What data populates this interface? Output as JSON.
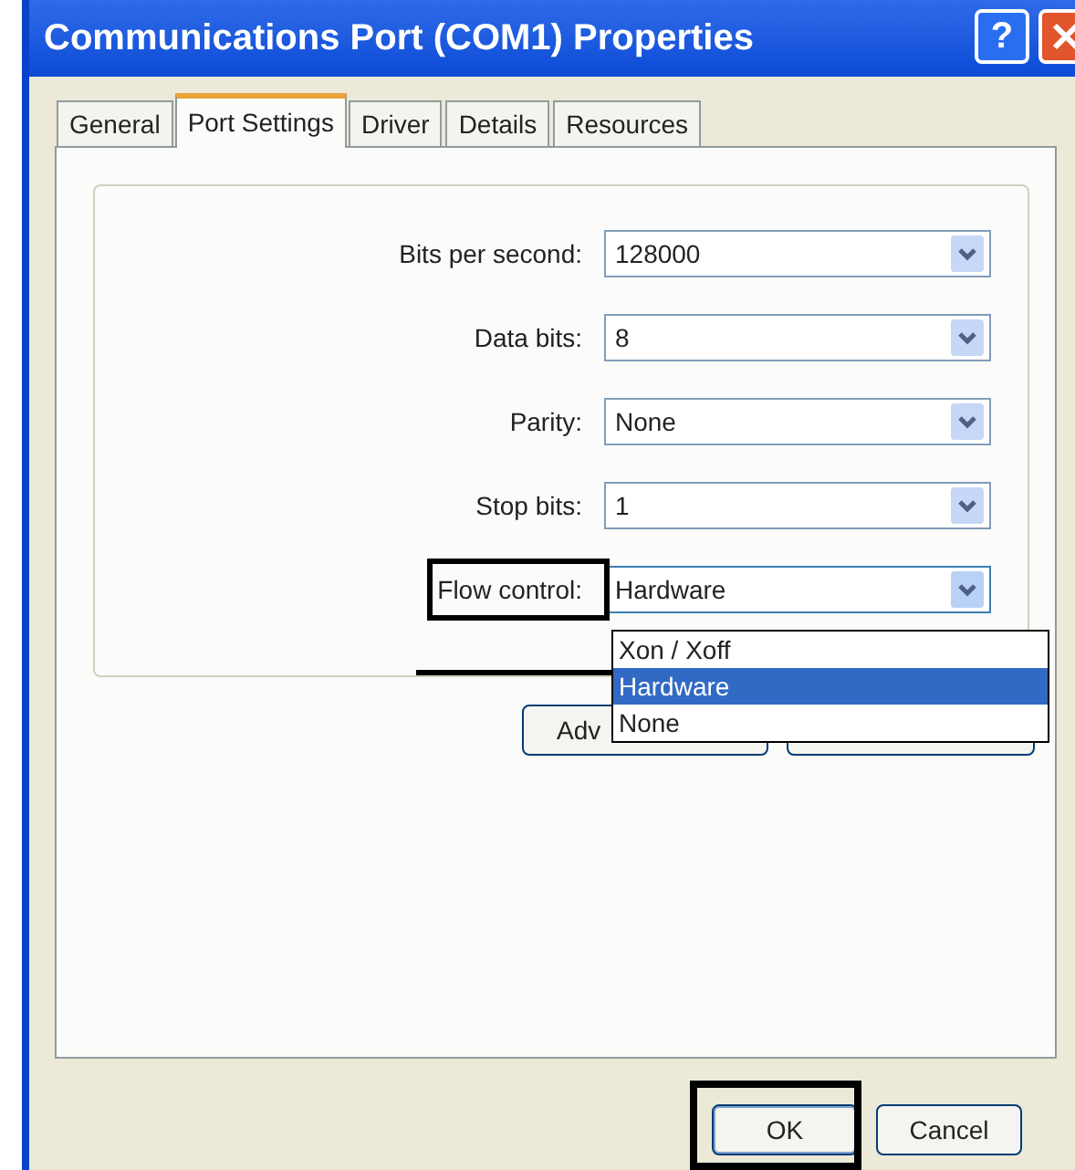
{
  "window": {
    "title": "Communications Port (COM1) Properties",
    "help": "?"
  },
  "tabs": [
    {
      "label": "General",
      "selected": false
    },
    {
      "label": "Port Settings",
      "selected": true
    },
    {
      "label": "Driver",
      "selected": false
    },
    {
      "label": "Details",
      "selected": false
    },
    {
      "label": "Resources",
      "selected": false
    }
  ],
  "fields": [
    {
      "label": "Bits per second:",
      "value": "128000",
      "expanded": false
    },
    {
      "label": "Data bits:",
      "value": "8",
      "expanded": false
    },
    {
      "label": "Parity:",
      "value": "None",
      "expanded": false
    },
    {
      "label": "Stop bits:",
      "value": "1",
      "expanded": false
    },
    {
      "label": "Flow control:",
      "value": "Hardware",
      "expanded": true
    }
  ],
  "dropdown_options": [
    {
      "label": "Xon / Xoff",
      "selected": false
    },
    {
      "label": "Hardware",
      "selected": true
    },
    {
      "label": "None",
      "selected": false
    }
  ],
  "advanced_button": "Adv",
  "buttons": [
    "OK",
    "Cancel"
  ]
}
